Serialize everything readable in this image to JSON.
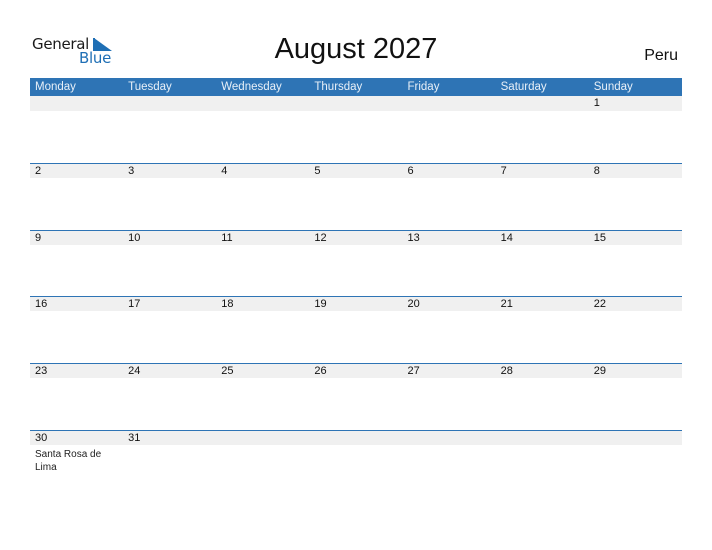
{
  "logo": {
    "general": "General",
    "blue": "Blue"
  },
  "title": "August 2027",
  "country": "Peru",
  "colors": {
    "header_bg": "#2e74b5",
    "date_strip": "#f0f0f0",
    "brand_blue": "#1f6fb5"
  },
  "weekdays": [
    "Monday",
    "Tuesday",
    "Wednesday",
    "Thursday",
    "Friday",
    "Saturday",
    "Sunday"
  ],
  "weeks": [
    {
      "days": [
        "",
        "",
        "",
        "",
        "",
        "",
        "1"
      ],
      "events": [
        "",
        "",
        "",
        "",
        "",
        "",
        ""
      ]
    },
    {
      "days": [
        "2",
        "3",
        "4",
        "5",
        "6",
        "7",
        "8"
      ],
      "events": [
        "",
        "",
        "",
        "",
        "",
        "",
        ""
      ]
    },
    {
      "days": [
        "9",
        "10",
        "11",
        "12",
        "13",
        "14",
        "15"
      ],
      "events": [
        "",
        "",
        "",
        "",
        "",
        "",
        ""
      ]
    },
    {
      "days": [
        "16",
        "17",
        "18",
        "19",
        "20",
        "21",
        "22"
      ],
      "events": [
        "",
        "",
        "",
        "",
        "",
        "",
        ""
      ]
    },
    {
      "days": [
        "23",
        "24",
        "25",
        "26",
        "27",
        "28",
        "29"
      ],
      "events": [
        "",
        "",
        "",
        "",
        "",
        "",
        ""
      ]
    },
    {
      "days": [
        "30",
        "31",
        "",
        "",
        "",
        "",
        ""
      ],
      "events": [
        "Santa Rosa de Lima",
        "",
        "",
        "",
        "",
        "",
        ""
      ]
    }
  ]
}
